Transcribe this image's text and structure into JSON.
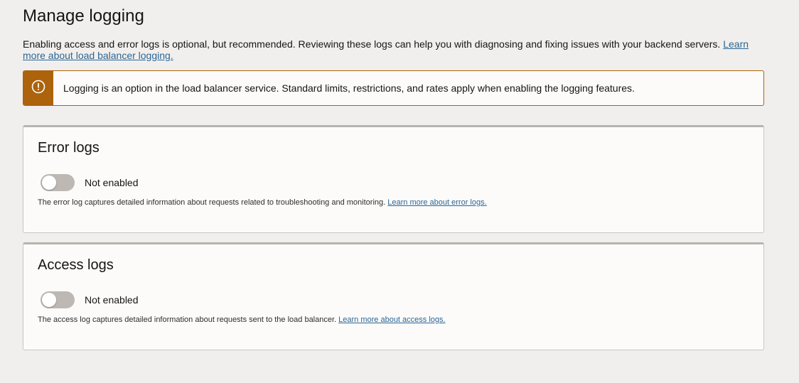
{
  "page": {
    "title": "Manage logging",
    "intro_text": "Enabling access and error logs is optional, but recommended. Reviewing these logs can help you with diagnosing and fixing issues with your backend servers. ",
    "intro_link": "Learn more about load balancer logging."
  },
  "notice": {
    "icon": "warning-circle-icon",
    "text": "Logging is an option in the load balancer service. Standard limits, restrictions, and rates apply when enabling the logging features.",
    "accent_color": "#ac630c"
  },
  "error_logs": {
    "title": "Error logs",
    "toggle_state": "Not enabled",
    "enabled": false,
    "helper_text": "The error log captures detailed information about requests related to troubleshooting and monitoring. ",
    "helper_link": "Learn more about error logs."
  },
  "access_logs": {
    "title": "Access logs",
    "toggle_state": "Not enabled",
    "enabled": false,
    "helper_text": "The access log captures detailed information about requests sent to the load balancer. ",
    "helper_link": "Learn more about access logs."
  }
}
